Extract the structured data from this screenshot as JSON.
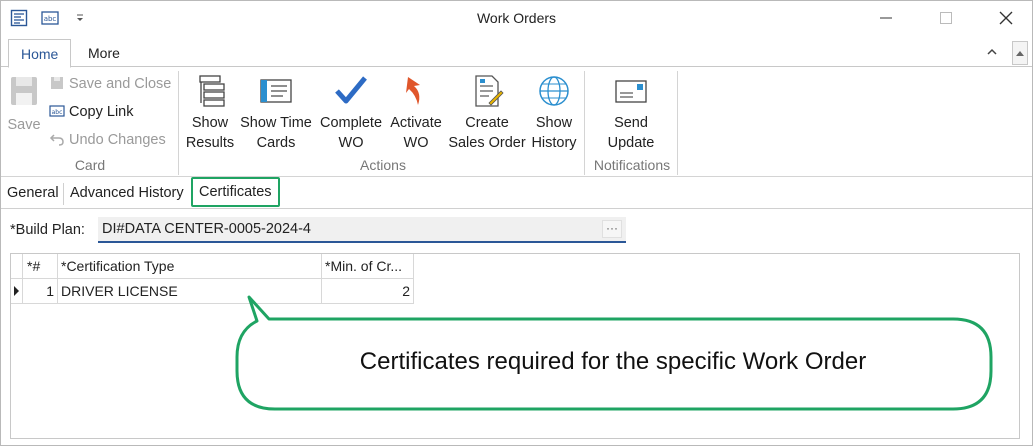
{
  "window": {
    "title": "Work Orders",
    "quick_access": [
      "form-icon",
      "abc-field-icon",
      "dropdown-arrow-icon"
    ],
    "controls": [
      "minimize-icon",
      "maximize-icon",
      "close-icon"
    ]
  },
  "ribbon_tabs": [
    {
      "label": "Home",
      "active": true
    },
    {
      "label": "More",
      "active": false
    }
  ],
  "ribbon": {
    "card": {
      "label": "Card",
      "save": "Save",
      "save_and_close": "Save and Close",
      "copy_link": "Copy Link",
      "undo_changes": "Undo Changes"
    },
    "actions": {
      "label": "Actions",
      "show_results": [
        "Show",
        "Results"
      ],
      "show_time_cards": [
        "Show Time",
        "Cards"
      ],
      "complete_wo": [
        "Complete",
        "WO"
      ],
      "activate_wo": [
        "Activate",
        "WO"
      ],
      "create_sales_order": [
        "Create",
        "Sales Order"
      ],
      "show_history": [
        "Show",
        "History"
      ]
    },
    "notifications": {
      "label": "Notifications",
      "send_update": [
        "Send",
        "Update"
      ]
    }
  },
  "content_tabs": [
    {
      "label": "General"
    },
    {
      "label": "Advanced History"
    },
    {
      "label": "Certificates",
      "active": true
    }
  ],
  "build_plan": {
    "label": "*Build Plan:",
    "value": "DI#DATA CENTER-0005-2024-4",
    "button": "···"
  },
  "grid": {
    "columns": [
      "*#",
      "*Certification Type",
      "*Min. of Cr..."
    ],
    "rows": [
      {
        "num": "1",
        "type": "DRIVER LICENSE",
        "min": "2"
      }
    ]
  },
  "callout": {
    "text": "Certificates required for the specific Work Order",
    "color": "#1fa463"
  },
  "colors": {
    "accent": "#2b5797",
    "highlight": "#1fa463",
    "check_blue": "#2d6bc4",
    "activate_orange": "#e0562b"
  }
}
